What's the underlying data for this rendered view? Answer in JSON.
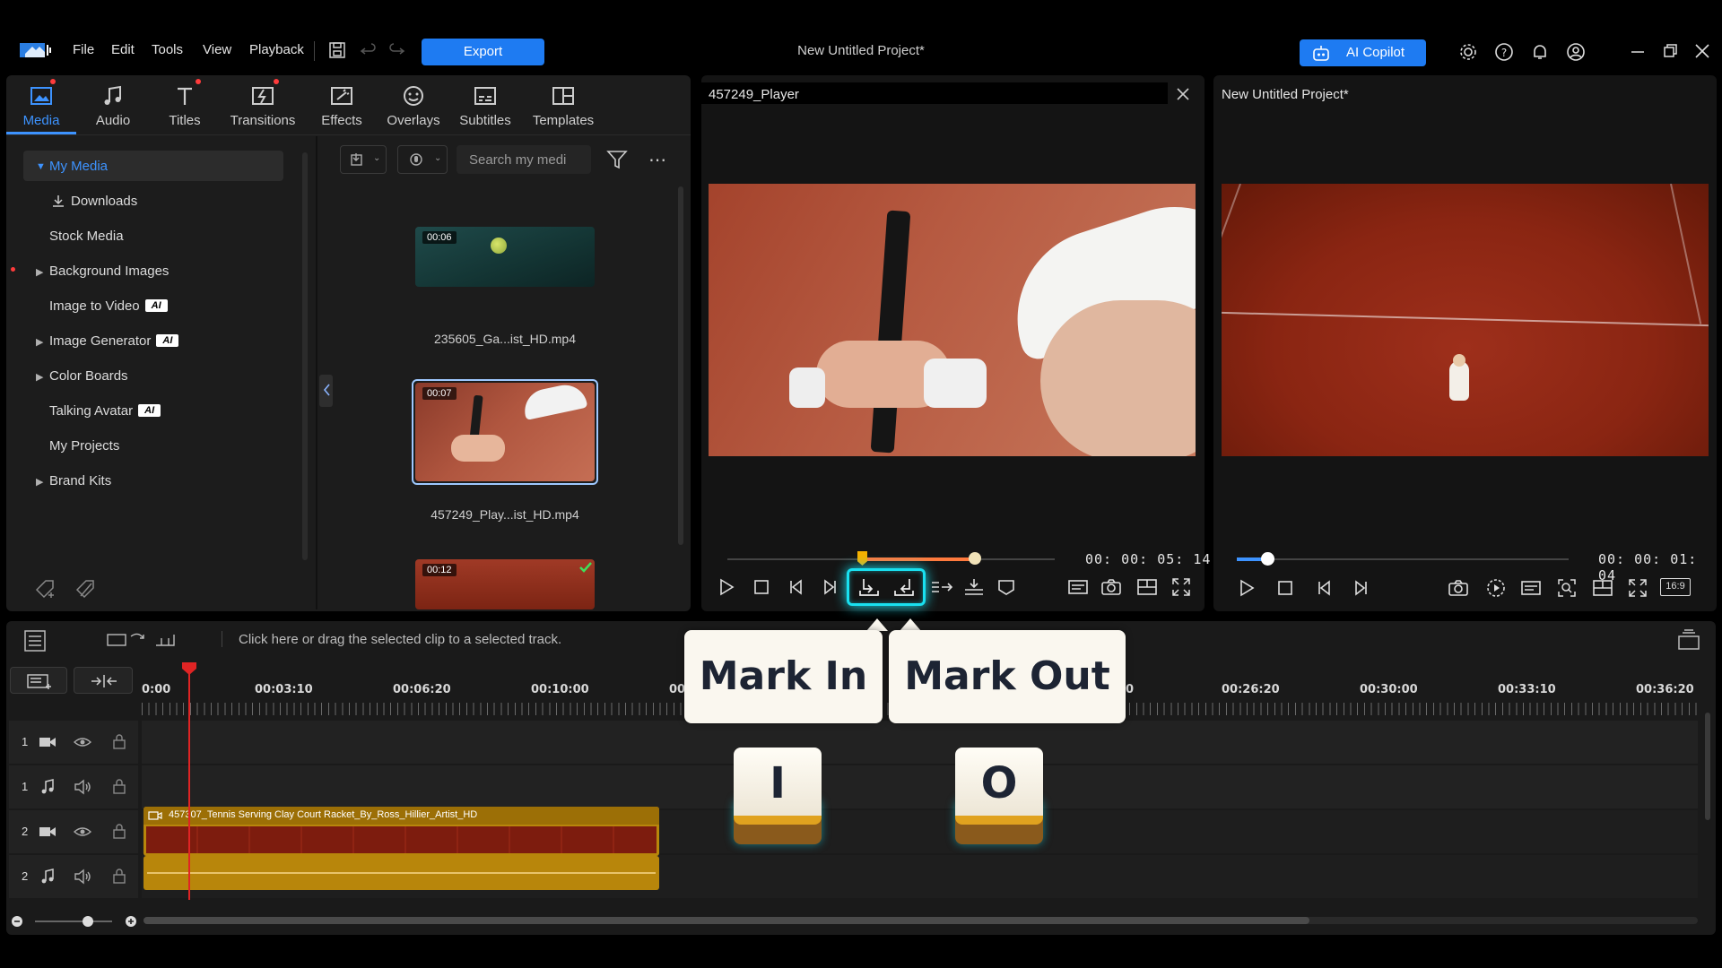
{
  "menu": {
    "file": "File",
    "edit": "Edit",
    "tools": "Tools",
    "view": "View",
    "playback": "Playback"
  },
  "toolbar": {
    "export_label": "Export",
    "copilot_label": "AI Copilot"
  },
  "window": {
    "title": "New Untitled Project*"
  },
  "library": {
    "tabs": [
      {
        "label": "Media"
      },
      {
        "label": "Audio"
      },
      {
        "label": "Titles"
      },
      {
        "label": "Transitions"
      },
      {
        "label": "Effects"
      },
      {
        "label": "Overlays"
      },
      {
        "label": "Subtitles"
      },
      {
        "label": "Templates"
      }
    ],
    "tree": {
      "my_media": "My Media",
      "downloads": "Downloads",
      "stock_media": "Stock Media",
      "background_images": "Background Images",
      "image_to_video": "Image to Video",
      "image_generator": "Image Generator",
      "color_boards": "Color Boards",
      "talking_avatar": "Talking Avatar",
      "my_projects": "My Projects",
      "brand_kits": "Brand Kits",
      "ai_badge": "AI"
    },
    "search_placeholder": "Search my medi",
    "clips": [
      {
        "duration": "00:06",
        "name": "235605_Ga...ist_HD.mp4"
      },
      {
        "duration": "00:07",
        "name": "457249_Play...ist_HD.mp4"
      },
      {
        "duration": "00:12",
        "name": ""
      }
    ]
  },
  "player": {
    "title": "457249_Player",
    "timecode": "00: 00: 05: 14"
  },
  "preview": {
    "title": "New Untitled Project*",
    "timecode": "00: 00: 01: 04",
    "aspect": "16:9"
  },
  "timeline": {
    "hint": "Click here or drag the selected clip to a selected track.",
    "ruler": [
      "0:00",
      "00:03:10",
      "00:06:20",
      "00:10:00",
      "00:",
      "0",
      "00:26:20",
      "00:30:00",
      "00:33:10",
      "00:36:20"
    ],
    "tracks": [
      "1",
      "1",
      "2",
      "2"
    ],
    "clip_name": "457307_Tennis Serving Clay Court Racket_By_Ross_Hillier_Artist_HD"
  },
  "overlay": {
    "mark_in": "Mark In",
    "mark_out": "Mark Out",
    "key_in": "I",
    "key_out": "O"
  },
  "colors": {
    "accent": "#1e7bf2",
    "active_tab": "#3d93ff",
    "highlight": "#19e0f0",
    "clip_bar": "#b8860b",
    "playhead": "#e02424"
  }
}
